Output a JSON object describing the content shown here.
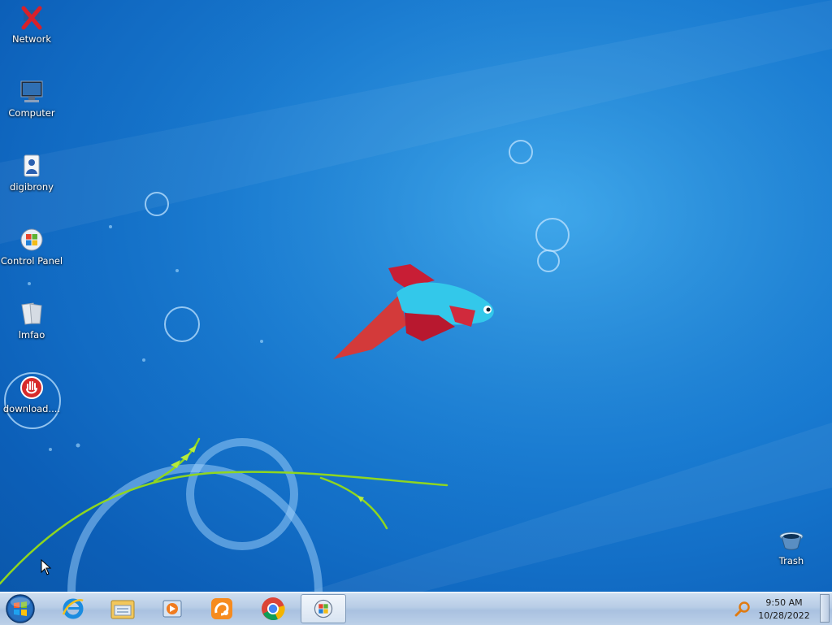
{
  "desktop": {
    "icons": [
      {
        "label": "Network",
        "icon": "network-disconnected-icon"
      },
      {
        "label": "Computer",
        "icon": "computer-icon"
      },
      {
        "label": "digibrony",
        "icon": "user-folder-icon"
      },
      {
        "label": "Control Panel",
        "icon": "control-panel-icon"
      },
      {
        "label": "lmfao",
        "icon": "folder-icon"
      },
      {
        "label": "download....",
        "icon": "download-stop-icon"
      }
    ],
    "trash": {
      "label": "Trash",
      "icon": "trash-icon"
    }
  },
  "taskbar": {
    "start": {
      "icon": "start-orb-icon"
    },
    "pinned": [
      {
        "name": "internet-explorer",
        "icon": "internet-explorer-icon"
      },
      {
        "name": "file-explorer",
        "icon": "file-explorer-icon"
      },
      {
        "name": "media-player",
        "icon": "media-player-icon"
      },
      {
        "name": "uc-browser",
        "icon": "uc-browser-icon"
      },
      {
        "name": "chrome",
        "icon": "chrome-icon"
      },
      {
        "name": "control-panel",
        "icon": "control-panel-icon",
        "active": true
      }
    ],
    "tray": {
      "search_icon": "search-icon",
      "time": "9:50 AM",
      "date": "10/28/2022"
    }
  },
  "colors": {
    "wallpaper_blue": "#1a7fd6",
    "fish_body": "#33c8ea",
    "fish_fin": "#c81e35",
    "grass": "#8fd620"
  }
}
